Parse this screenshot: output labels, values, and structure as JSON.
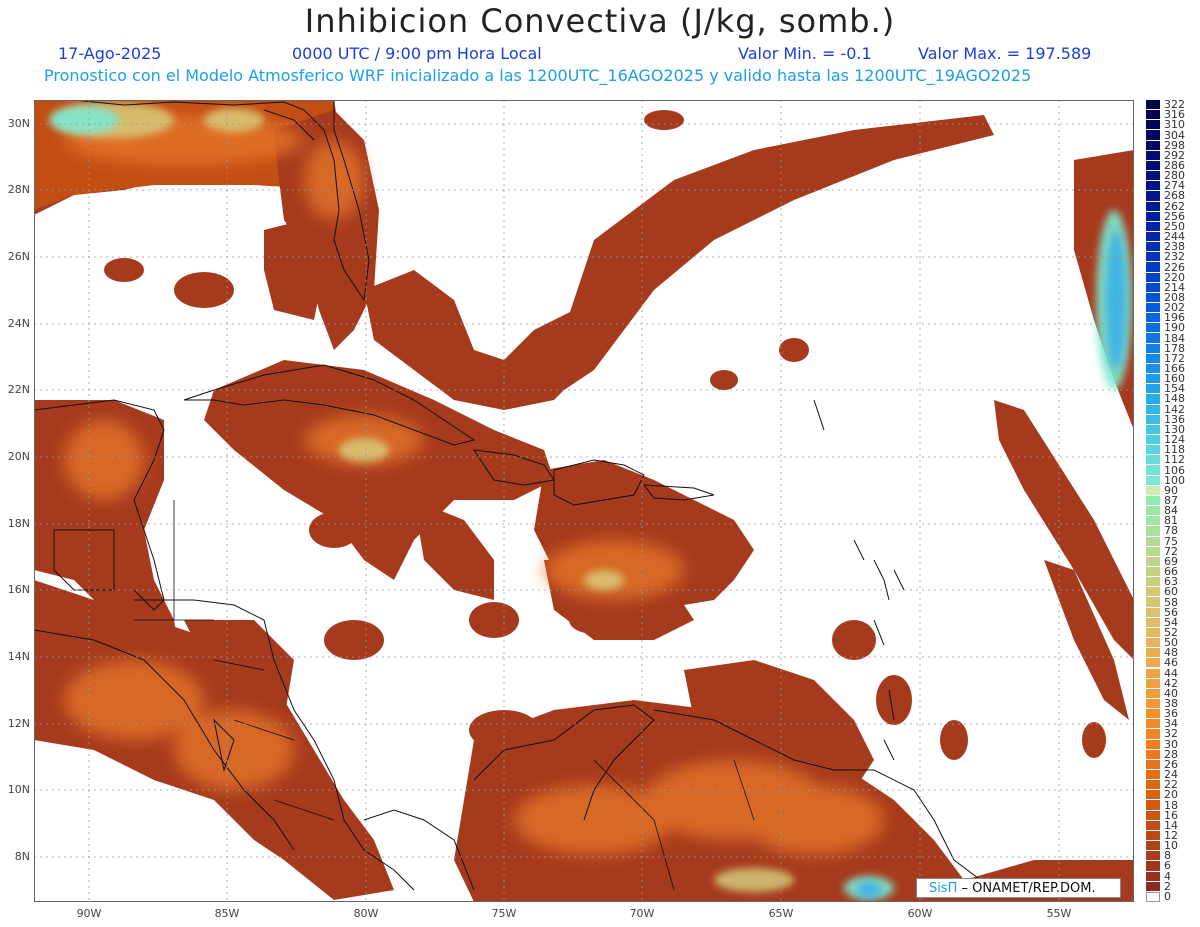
{
  "title": "Inhibicion Convectiva (J/kg, somb.)",
  "date": "17-Ago-2025",
  "time": "0000 UTC / 9:00 pm Hora Local",
  "min_label": "Valor Min. = -0.1",
  "max_label": "Valor Max. = 197.589",
  "subtitle": "Pronostico con el Modelo Atmosferico WRF inicializado a las 1200UTC_16AGO2025 y valido hasta las  1200UTC_19AGO2025",
  "lat_labels": [
    "30N",
    "28N",
    "26N",
    "24N",
    "22N",
    "20N",
    "18N",
    "16N",
    "14N",
    "12N",
    "10N",
    "8N"
  ],
  "lon_labels": [
    "90W",
    "85W",
    "80W",
    "75W",
    "70W",
    "65W",
    "60W",
    "55W"
  ],
  "legend": {
    "values": [
      "0",
      "2",
      "4",
      "6",
      "8",
      "10",
      "12",
      "14",
      "16",
      "18",
      "20",
      "22",
      "24",
      "26",
      "28",
      "30",
      "32",
      "34",
      "36",
      "38",
      "40",
      "42",
      "44",
      "46",
      "48",
      "50",
      "52",
      "54",
      "56",
      "58",
      "60",
      "63",
      "66",
      "69",
      "72",
      "75",
      "78",
      "81",
      "84",
      "87",
      "90",
      "100",
      "106",
      "112",
      "118",
      "124",
      "130",
      "136",
      "142",
      "148",
      "154",
      "160",
      "166",
      "172",
      "178",
      "184",
      "190",
      "196",
      "202",
      "208",
      "214",
      "220",
      "226",
      "232",
      "238",
      "244",
      "250",
      "256",
      "262",
      "268",
      "274",
      "280",
      "286",
      "292",
      "298",
      "304",
      "310",
      "316",
      "322"
    ],
    "colors": [
      "#ffffff",
      "#8c2a22",
      "#96301f",
      "#a0361c",
      "#a93c1a",
      "#b24218",
      "#ba4816",
      "#c24e14",
      "#ca5413",
      "#d25a12",
      "#da6012",
      "#e16613",
      "#e66c15",
      "#eb7218",
      "#ee781c",
      "#f07e20",
      "#f18425",
      "#f28a2a",
      "#f29030",
      "#f29636",
      "#f19c3c",
      "#f0a042",
      "#eea548",
      "#ecaa4e",
      "#e9af54",
      "#e6b45a",
      "#e3b960",
      "#dfbd66",
      "#dbc16c",
      "#d7c572",
      "#d3c978",
      "#cdcd7e",
      "#c7d184",
      "#c0d58a",
      "#b8d990",
      "#b0dd96",
      "#a8e19c",
      "#a0e5a2",
      "#98e8a8",
      "#90ebae",
      "#cdeeb0",
      "#7ee8d0",
      "#72e3d5",
      "#66ddda",
      "#5ad6de",
      "#4ecfe2",
      "#44c7e5",
      "#3abee8",
      "#32b5ea",
      "#2aaceb",
      "#23a3ec",
      "#1d9aec",
      "#1891eb",
      "#1488ea",
      "#107fe8",
      "#0d76e5",
      "#0b6de2",
      "#0964de",
      "#085bda",
      "#0752d5",
      "#064ad0",
      "#0542ca",
      "#043bc4",
      "#0434bd",
      "#032eb6",
      "#0328af",
      "#0323a8",
      "#021ea0",
      "#021a98",
      "#021690",
      "#021388",
      "#021080",
      "#020d78",
      "#020b70",
      "#020968",
      "#020760",
      "#020658",
      "#020550",
      "#020448"
    ]
  },
  "credit": {
    "brand": "SisΠ",
    "text": " – ONAMET/REP.DOM."
  }
}
